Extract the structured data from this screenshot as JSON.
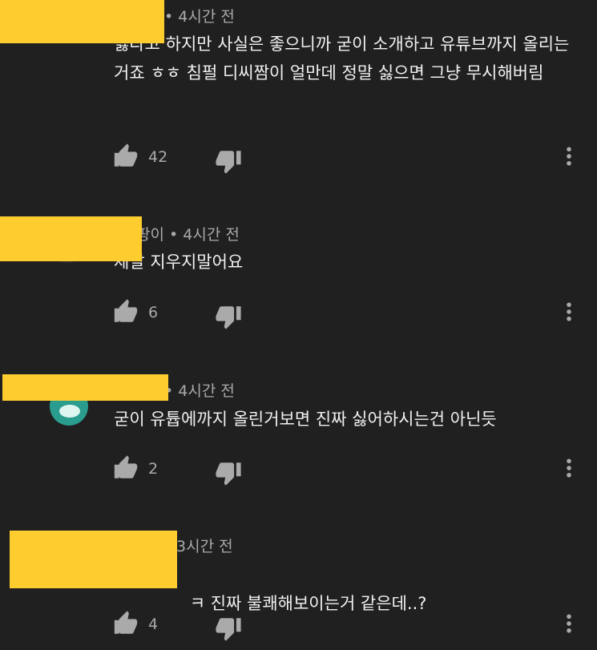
{
  "comments": [
    {
      "author": "",
      "time": "4시간 전",
      "text": "싫다고 하지만 사실은 좋으니까 굳이 소개하고 유튜브까지 올리는 거죠 ㅎㅎ 침펄 디씨짬이 얼만데 정말 싫으면 그냥 무시해버림",
      "likes": "42"
    },
    {
      "author": "팡이",
      "time": "4시간 전",
      "text": "제발 지우지말어요",
      "likes": "6"
    },
    {
      "author": "",
      "time": "4시간 전",
      "text": "굳이 유튭에까지 올린거보면 진짜 싫어하시는건 아닌듯",
      "likes": "2"
    },
    {
      "author": "",
      "time": "3시간 전",
      "text": "진짜 불쾌해보이는거 같은데..?",
      "likes": "4"
    }
  ],
  "colors": {
    "background": "#202020",
    "text": "#f1f1f1",
    "meta": "#aaaaaa",
    "redaction": "#fdcc2e",
    "icon": "#aaaaaa"
  },
  "icons": [
    "like-icon",
    "dislike-icon",
    "more-vert-icon"
  ]
}
